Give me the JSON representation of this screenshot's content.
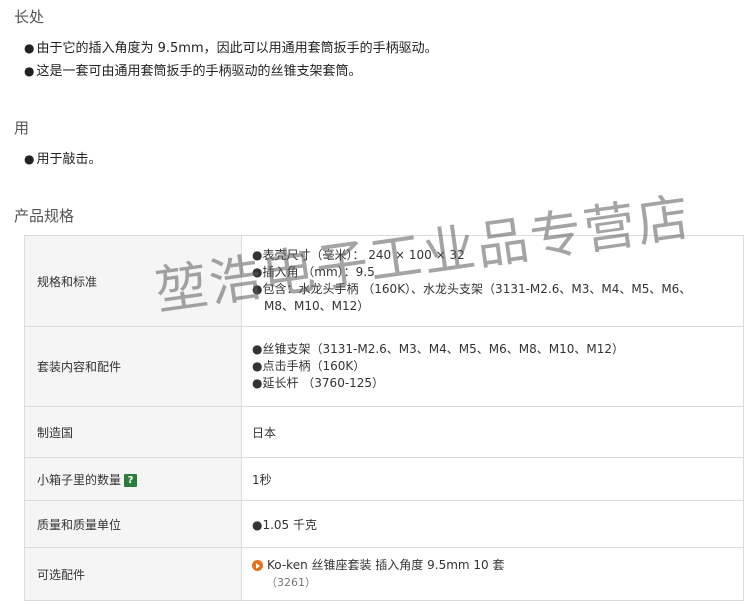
{
  "features": {
    "title": "长处",
    "items": [
      "由于它的插入角度为 9.5mm，因此可以用通用套筒扳手的手柄驱动。",
      "这是一套可由通用套筒扳手的手柄驱动的丝锥支架套筒。"
    ]
  },
  "usage": {
    "title": "用",
    "items": [
      "用于敲击。"
    ]
  },
  "bullet_char": "●",
  "specs": {
    "title": "产品规格",
    "rows": {
      "spec": {
        "label": "规格和标准",
        "lines": [
          "●表壳尺寸（毫米）：  240 × 100 × 32",
          "●插入角 （mm）：9.5",
          "●包含：水龙头手柄 （160K）、水龙头支架（3131-M2.6、M3、M4、M5、M6、",
          "M8、M10、M12）"
        ]
      },
      "contents": {
        "label": "套装内容和配件",
        "lines": [
          "●丝锥支架（3131-M2.6、M3、M4、M5、M6、M8、M10、M12）",
          "●点击手柄（160K）",
          "●延长杆 （3760-125）"
        ]
      },
      "origin": {
        "label": "制造国",
        "value": "日本"
      },
      "quantity": {
        "label": "小箱子里的数量",
        "help_icon": "?",
        "value": "1秒"
      },
      "weight": {
        "label": "质量和质量单位",
        "value": "●1.05 千克"
      },
      "options": {
        "label": "可选配件",
        "link_text": "Ko-ken 丝锥座套装 插入角度 9.5mm 10 套",
        "code": "（3261）"
      }
    }
  },
  "watermark": "堃浩电子工业品专营店",
  "colors": {
    "help_badge": "#2d7d3a",
    "link_icon": "#e8701a",
    "label_bg": "#f5f5f5"
  }
}
